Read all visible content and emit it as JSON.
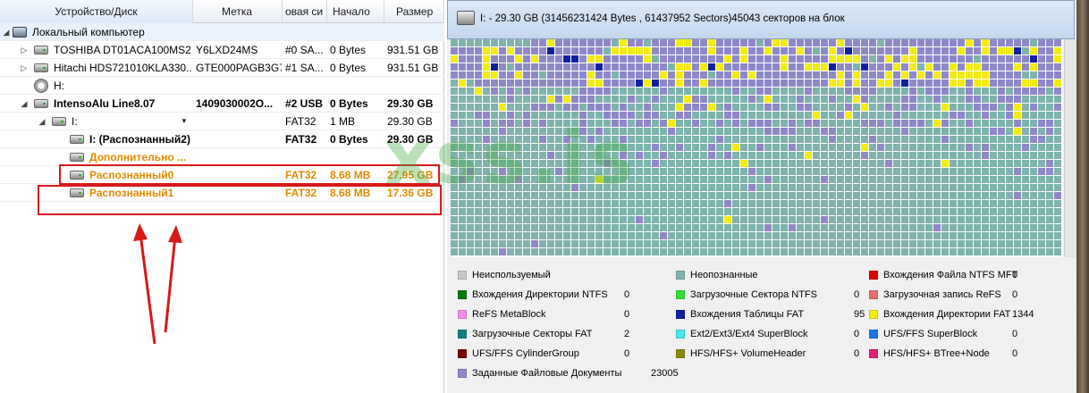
{
  "tree": {
    "columns": [
      "Устройство/Диск",
      "Метка",
      "овая си",
      "Начало",
      "Размер"
    ],
    "rows": [
      {
        "name": "Локальный компьютер",
        "label": "",
        "fs": "",
        "start": "",
        "size": ""
      },
      {
        "name": "TOSHIBA DT01ACA100MS2...",
        "label": "Y6LXD24MS",
        "fs": "#0 SA...",
        "start": "0 Bytes",
        "size": "931.51 GB"
      },
      {
        "name": "Hitachi HDS721010KLA330...",
        "label": "GTE000PAGB3G7E",
        "fs": "#1 SA...",
        "start": "0 Bytes",
        "size": "931.51 GB"
      },
      {
        "name": "H:",
        "label": "",
        "fs": "",
        "start": "",
        "size": ""
      },
      {
        "name": "IntensoAlu Line8.07",
        "label": "1409030002O...",
        "fs": "#2 USB",
        "start": "0 Bytes",
        "size": "29.30 GB"
      },
      {
        "name": "I:",
        "label": "",
        "fs": "FAT32",
        "start": "1 MB",
        "size": "29.30 GB"
      },
      {
        "name": "I: (Распознанный2)",
        "label": "",
        "fs": "FAT32",
        "start": "0 Bytes",
        "size": "29.30 GB"
      },
      {
        "name": "Дополнительно ...",
        "label": "",
        "fs": "",
        "start": "",
        "size": ""
      },
      {
        "name": "Распознанный0",
        "label": "",
        "fs": "FAT32",
        "start": "8.68 MB",
        "size": "27.95 GB"
      },
      {
        "name": "Распознанный1",
        "label": "",
        "fs": "FAT32",
        "start": "8.68 MB",
        "size": "17.36 GB"
      }
    ]
  },
  "map": {
    "title": "I: - 29.30 GB (31456231424 Bytes , 61437952 Sectors)45043 секторов на блок",
    "colors": {
      "unknown": "#7fb3ad",
      "docs": "#8e88c8",
      "fat_dir": "#f2ec14",
      "fat_table": "#1020a0",
      "unused": "#c8c8c8"
    }
  },
  "legend": [
    {
      "label": "Неиспользуемый",
      "count": "",
      "color": "#c8c8c8"
    },
    {
      "label": "Неопознанные",
      "count": "",
      "color": "#7fb3ad"
    },
    {
      "label": "Вхождения Файла NTFS MFT",
      "count": "0",
      "color": "#e00000"
    },
    {
      "label": "Вхождения Директории NTFS",
      "count": "0",
      "color": "#0a7a0a"
    },
    {
      "label": "Загрузочные Сектора NTFS",
      "count": "0",
      "color": "#33e033"
    },
    {
      "label": "Загрузочная запись ReFS",
      "count": "0",
      "color": "#e87070"
    },
    {
      "label": "ReFS MetaBlock",
      "count": "0",
      "color": "#f28ae8"
    },
    {
      "label": "Вхождения Таблицы FAT",
      "count": "95",
      "color": "#1020a0"
    },
    {
      "label": "Вхождения Директории FAT",
      "count": "1344",
      "color": "#f2ec14"
    },
    {
      "label": "Загрузочные Секторы FAT",
      "count": "2",
      "color": "#0f8080"
    },
    {
      "label": "Ext2/Ext3/Ext4 SuperBlock",
      "count": "0",
      "color": "#44e8ee"
    },
    {
      "label": "UFS/FFS SuperBlock",
      "count": "0",
      "color": "#1a78e0"
    },
    {
      "label": "UFS/FFS CylinderGroup",
      "count": "0",
      "color": "#7a0000"
    },
    {
      "label": "HFS/HFS+ VolumeHeader",
      "count": "0",
      "color": "#8a8a10"
    },
    {
      "label": "HFS/HFS+ BTree+Node",
      "count": "0",
      "color": "#e0207a"
    },
    {
      "label": "Заданные Файловые Документы",
      "count": "23005",
      "color": "#8e88c8"
    }
  ],
  "watermark": "xss.is"
}
